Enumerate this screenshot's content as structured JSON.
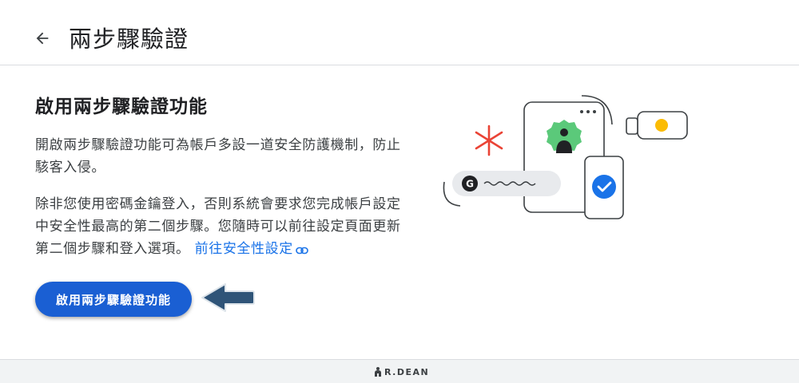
{
  "header": {
    "title": "兩步驟驗證"
  },
  "main": {
    "section_title": "啟用兩步驟驗證功能",
    "paragraph1": "開啟兩步驟驗證功能可為帳戶多設一道安全防護機制，防止駭客入侵。",
    "paragraph2": "除非您使用密碼金鑰登入，否則系統會要求您完成帳戶設定中安全性最高的第二個步驟。您隨時可以前往設定頁面更新第二個步驟和登入選項。",
    "link_text": "前往安全性設定",
    "button_label": "啟用兩步驟驗證功能"
  },
  "illustration": {
    "badge_letter": "G",
    "colors": {
      "asterisk": "#ea4335",
      "shield_green": "#5bc97a",
      "check_blue": "#1a73e8",
      "yellow_dot": "#fbbc04"
    }
  },
  "annotation": {
    "arrow_color": "#2f5478"
  },
  "footer": {
    "logo_text": "R.DEAN"
  },
  "icons": {
    "back": "arrow-left-icon",
    "link": "link-icon"
  }
}
